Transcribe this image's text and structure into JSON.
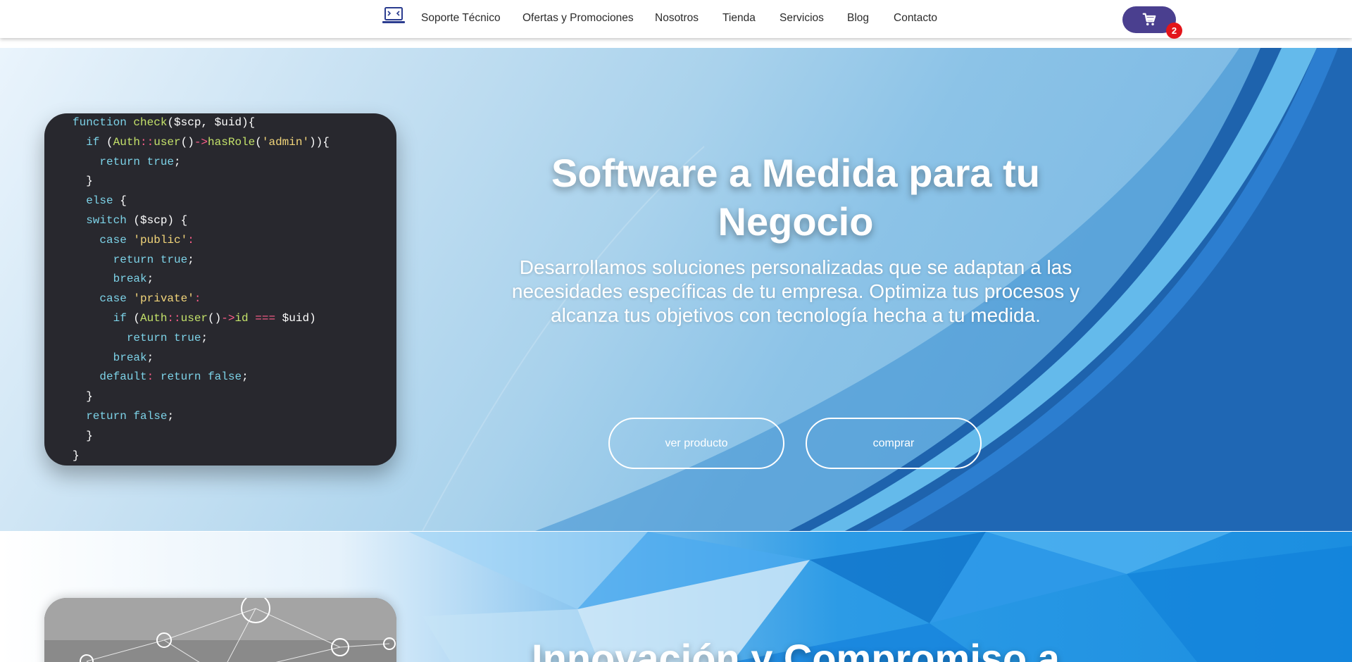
{
  "header": {
    "logo_icon": "laptop-code-icon",
    "nav": [
      {
        "label": "Soporte Técnico"
      },
      {
        "label": "Ofertas y Promociones"
      },
      {
        "label": "Nosotros"
      },
      {
        "label": "Tienda"
      },
      {
        "label": "Servicios"
      },
      {
        "label": "Blog"
      },
      {
        "label": "Contacto"
      }
    ],
    "cart": {
      "icon": "cart-icon",
      "count": "2",
      "color": "#4a3f8f",
      "badge_color": "#e3151b"
    }
  },
  "hero": {
    "title": "Software a Medida para tu Negocio",
    "description": "Desarrollamos soluciones personalizadas que se adaptan a las necesidades específicas de tu empresa. Optimiza tus procesos y alcanza tus objetivos con tecnología hecha a tu medida.",
    "buttons": [
      {
        "label": "ver producto"
      },
      {
        "label": "comprar"
      }
    ],
    "code": {
      "lines": [
        "function check($scp, $uid){",
        "  if (Auth::user()->hasRole('admin')){",
        "    return true;",
        "  }",
        "  else {",
        "  switch ($scp) {",
        "    case 'public':",
        "      return true;",
        "      break;",
        "    case 'private':",
        "      if (Auth::user()->id === $uid)",
        "        return true;",
        "      break;",
        "    default: return false;",
        "  }",
        "  return false;",
        "  }",
        "}"
      ]
    }
  },
  "section2": {
    "title": "Innovación y Compromiso a",
    "image_icon": "network-people-image"
  }
}
